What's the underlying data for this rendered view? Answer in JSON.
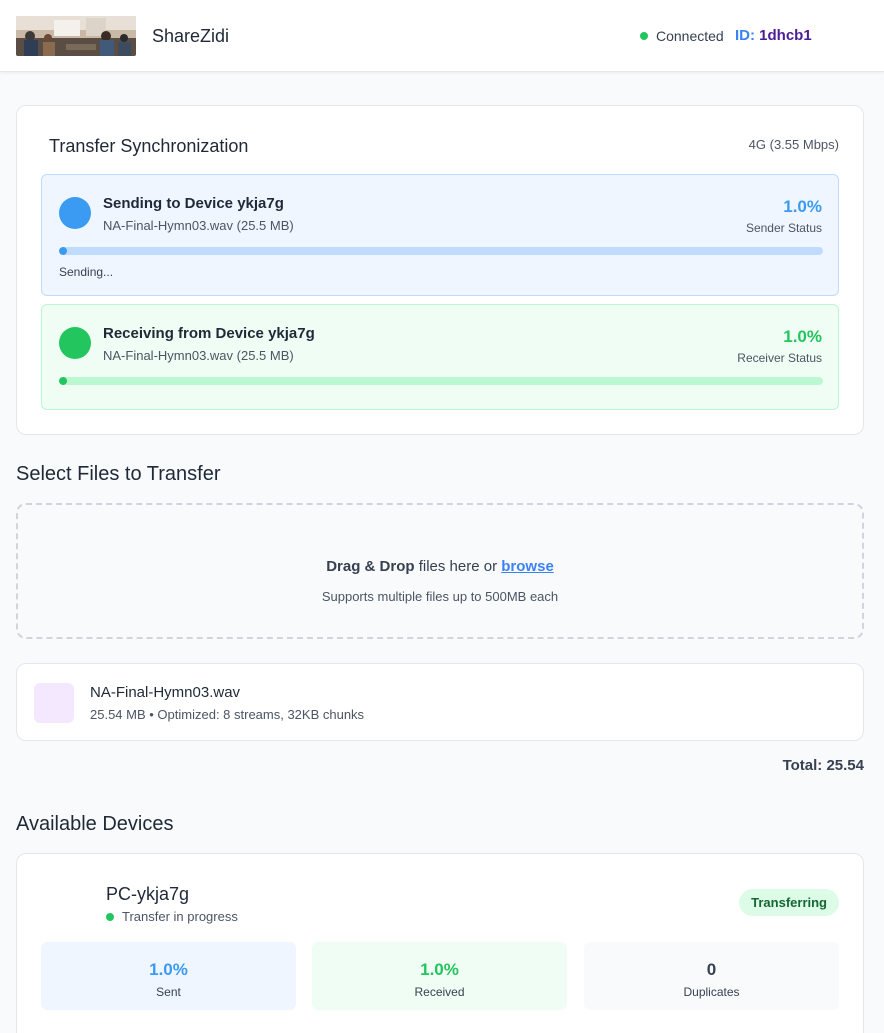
{
  "header": {
    "app_title": "ShareZidi",
    "connection_status": "Connected",
    "id_prefix": "ID: ",
    "id_value": "1dhcb1",
    "status_color": "#22c55e"
  },
  "sync": {
    "title": "Transfer Synchronization",
    "network": "4G (3.55 Mbps)",
    "sender": {
      "title": "Sending to Device ykja7g",
      "file": "NA-Final-Hymn03.wav (25.5 MB)",
      "percent_text": "1.0%",
      "progress": 1.0,
      "status_label": "Sender Status",
      "state_text": "Sending..."
    },
    "receiver": {
      "title": "Receiving from Device ykja7g",
      "file": "NA-Final-Hymn03.wav (25.5 MB)",
      "percent_text": "1.0%",
      "progress": 1.0,
      "status_label": "Receiver Status"
    }
  },
  "files_section": {
    "title": "Select Files to Transfer",
    "drop_bold": "Drag & Drop",
    "drop_text": " files here or ",
    "browse_label": "browse",
    "drop_hint": "Supports multiple files up to 500MB each"
  },
  "file_item": {
    "name": "NA-Final-Hymn03.wav",
    "meta": "25.54 MB • Optimized: 8 streams, 32KB chunks"
  },
  "total": "Total: 25.54",
  "devices_section": {
    "title": "Available Devices",
    "device": {
      "name": "PC-ykja7g",
      "status": "Transfer in progress",
      "badge": "Transferring",
      "stats": {
        "sent_value": "1.0%",
        "sent_label": "Sent",
        "received_value": "1.0%",
        "received_label": "Received",
        "duplicates_value": "0",
        "duplicates_label": "Duplicates"
      }
    }
  },
  "colors": {
    "accent_blue": "#3b9bf2",
    "accent_green": "#22c55e",
    "id_color": "#4c1d95"
  }
}
